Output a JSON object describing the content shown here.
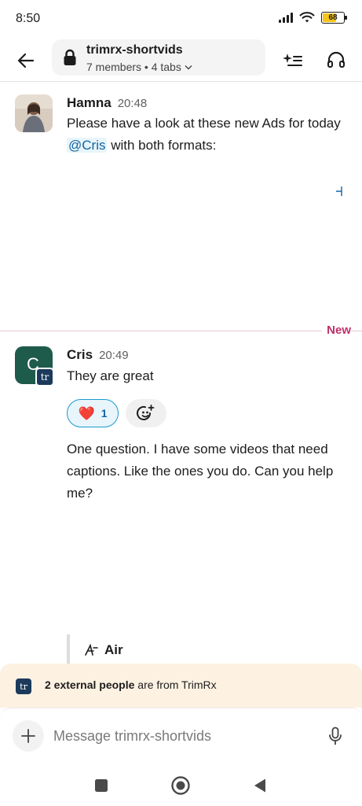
{
  "status_bar": {
    "time": "8:50",
    "battery": "68",
    "battery_level": 0.68,
    "icons": [
      "signal-icon",
      "wifi-icon",
      "battery-icon"
    ]
  },
  "header": {
    "channel_name": "trimrx-shortvids",
    "channel_meta": "7 members • 4 tabs",
    "icons": [
      "back-arrow-icon",
      "lock-icon",
      "chevron-down-icon",
      "ai-summary-icon",
      "headphones-icon"
    ]
  },
  "messages": [
    {
      "sender": "Hamna",
      "time": "20:48",
      "text_before": "Please have a look at these new Ads for today ",
      "mention": "@Cris",
      "text_after": " with both formats:"
    },
    {
      "sender": "Cris",
      "time": "20:49",
      "avatar_letter": "C",
      "avatar_badge": "tr",
      "text": "They are great",
      "reaction_emoji": "❤️",
      "reaction_count": "1",
      "followup_text": "One question. I have some videos that need captions. Like the ones you do. Can you help me?",
      "attachment_label": "Air"
    }
  ],
  "new_divider": "New",
  "external_banner": {
    "logo": "tr",
    "bold": "2 external people",
    "rest": " are from TrimRx"
  },
  "composer": {
    "placeholder": "Message trimrx-shortvids"
  },
  "colors": {
    "accent": "#1264a3",
    "new_label": "#c0306b",
    "cris_avatar": "#1e5b4a",
    "banner_bg": "#fdf1e2"
  }
}
